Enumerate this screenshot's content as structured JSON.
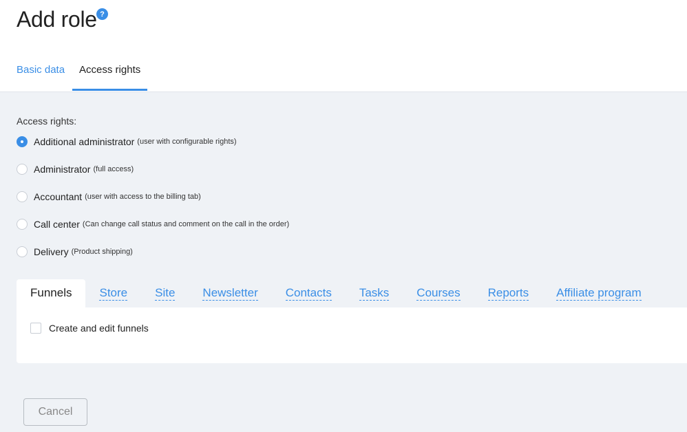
{
  "page": {
    "title": "Add role",
    "help_icon": "?"
  },
  "top_tabs": [
    {
      "label": "Basic data",
      "active": false
    },
    {
      "label": "Access rights",
      "active": true
    }
  ],
  "access": {
    "section_label": "Access rights:",
    "options": [
      {
        "label": "Additional administrator",
        "note": "(user with configurable rights)",
        "checked": true
      },
      {
        "label": "Administrator",
        "note": "(full access)",
        "checked": false
      },
      {
        "label": "Accountant",
        "note": "(user with access to the billing tab)",
        "checked": false
      },
      {
        "label": "Call center",
        "note": "(Can change call status and comment on the call in the order)",
        "checked": false
      },
      {
        "label": "Delivery",
        "note": "(Product shipping)",
        "checked": false
      }
    ]
  },
  "permission_tabs": [
    {
      "label": "Funnels",
      "active": true
    },
    {
      "label": "Store",
      "active": false
    },
    {
      "label": "Site",
      "active": false
    },
    {
      "label": "Newsletter",
      "active": false
    },
    {
      "label": "Contacts",
      "active": false
    },
    {
      "label": "Tasks",
      "active": false
    },
    {
      "label": "Courses",
      "active": false
    },
    {
      "label": "Reports",
      "active": false
    },
    {
      "label": "Affiliate program",
      "active": false
    }
  ],
  "funnels_panel": {
    "checkbox_label": "Create and edit funnels",
    "checked": false
  },
  "buttons": {
    "cancel": "Cancel"
  },
  "colors": {
    "accent": "#3a8ee6",
    "background": "#eff2f6"
  }
}
